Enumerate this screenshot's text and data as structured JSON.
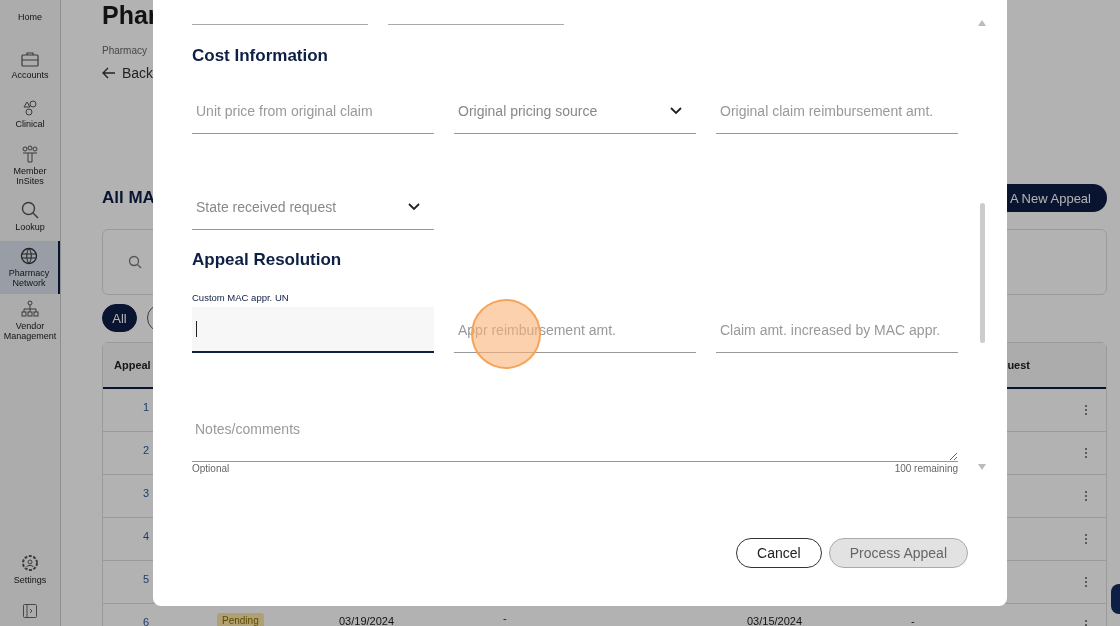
{
  "sidebar": {
    "items": [
      {
        "label": "Home",
        "selected": false
      },
      {
        "label": "Accounts",
        "selected": false
      },
      {
        "label": "Clinical",
        "selected": false
      },
      {
        "label": "Member InSites",
        "selected": false
      },
      {
        "label": "Lookup",
        "selected": false
      },
      {
        "label": "Pharmacy Network",
        "selected": true
      },
      {
        "label": "Vendor Management",
        "selected": false
      }
    ],
    "settings": "Settings"
  },
  "page": {
    "title": "Phar",
    "breadcrumb": "Pharmacy",
    "back": "Back",
    "section_title": "All MA",
    "new_button": "A New Appeal",
    "filters": [
      {
        "label": "All",
        "selected": true
      },
      {
        "selected": false
      }
    ],
    "table": {
      "columns": [
        "Appeal",
        "uest"
      ],
      "rows": [
        {
          "id": "1"
        },
        {
          "id": "2"
        },
        {
          "id": "3"
        },
        {
          "id": "4"
        },
        {
          "id": "5"
        },
        {
          "id": "6",
          "status": "Pending",
          "date_1": "03/19/2024",
          "value_1": "-",
          "date_2": "03/15/2024",
          "value_2": "-"
        }
      ]
    }
  },
  "modal": {
    "sections": [
      {
        "title": "Cost Information",
        "fields": [
          {
            "kind": "text",
            "placeholder": "Unit price from original claim"
          },
          {
            "kind": "select",
            "placeholder": "Original pricing source"
          },
          {
            "kind": "text",
            "placeholder": "Original claim reimbursement amt."
          },
          {
            "kind": "select",
            "placeholder": "State received request"
          }
        ]
      },
      {
        "title": "Appeal Resolution",
        "fields": [
          {
            "kind": "text",
            "label": "Custom MAC appr. UN",
            "focused": true
          },
          {
            "kind": "text",
            "placeholder": "Appr reimbursement amt."
          },
          {
            "kind": "text",
            "placeholder": "Claim amt. increased by MAC appr."
          }
        ]
      }
    ],
    "notes": {
      "placeholder": "Notes/comments",
      "helper": "Optional",
      "counter": "100 remaining"
    },
    "buttons": [
      {
        "label": "Cancel",
        "disabled": false
      },
      {
        "label": "Process Appeal",
        "disabled": true
      }
    ]
  }
}
